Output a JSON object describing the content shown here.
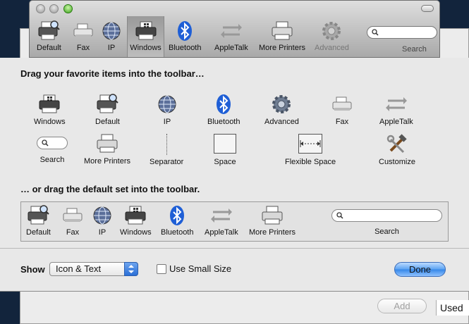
{
  "background_window": {
    "add_label": "Add",
    "used_label": "Used"
  },
  "toolbar": {
    "items": [
      {
        "label": "Default",
        "icon": "printer-magnifier-icon"
      },
      {
        "label": "Fax",
        "icon": "fax-icon"
      },
      {
        "label": "IP",
        "icon": "globe-icon"
      },
      {
        "label": "Windows",
        "icon": "windows-printer-icon",
        "selected": true
      },
      {
        "label": "Bluetooth",
        "icon": "bluetooth-icon"
      },
      {
        "label": "AppleTalk",
        "icon": "appletalk-icon"
      },
      {
        "label": "More Printers",
        "icon": "printer-icon"
      },
      {
        "label": "Advanced",
        "icon": "gear-icon",
        "disabled": true
      }
    ],
    "search_label": "Search"
  },
  "sheet": {
    "drag_heading": "Drag your favorite items into the toolbar…",
    "palette": [
      {
        "label": "Windows",
        "icon": "windows-printer-icon"
      },
      {
        "label": "Default",
        "icon": "printer-magnifier-icon"
      },
      {
        "label": "IP",
        "icon": "globe-icon"
      },
      {
        "label": "Bluetooth",
        "icon": "bluetooth-icon"
      },
      {
        "label": "Advanced",
        "icon": "gear-icon"
      },
      {
        "label": "Fax",
        "icon": "fax-icon"
      },
      {
        "label": "AppleTalk",
        "icon": "appletalk-icon"
      },
      {
        "label": "Search",
        "icon": "search-field-icon"
      },
      {
        "label": "More Printers",
        "icon": "printer-icon"
      },
      {
        "label": "Separator",
        "icon": "separator-icon"
      },
      {
        "label": "Space",
        "icon": "space-icon"
      },
      {
        "label": "Flexible Space",
        "icon": "flexible-space-icon"
      },
      {
        "label": "Customize",
        "icon": "customize-tools-icon"
      }
    ],
    "default_heading": "… or drag the default set into the toolbar.",
    "default_set": [
      {
        "label": "Default",
        "icon": "printer-magnifier-icon"
      },
      {
        "label": "Fax",
        "icon": "fax-icon"
      },
      {
        "label": "IP",
        "icon": "globe-icon"
      },
      {
        "label": "Windows",
        "icon": "windows-printer-icon"
      },
      {
        "label": "Bluetooth",
        "icon": "bluetooth-icon"
      },
      {
        "label": "AppleTalk",
        "icon": "appletalk-icon"
      },
      {
        "label": "More Printers",
        "icon": "printer-icon"
      },
      {
        "label": "Search",
        "icon": "search-field-icon"
      }
    ],
    "show_label": "Show",
    "show_value": "Icon & Text",
    "small_size_label": "Use Small Size",
    "small_size_checked": false,
    "done_label": "Done"
  },
  "colors": {
    "accent_blue": "#3486e8",
    "bluetooth_blue": "#1f5fd6"
  }
}
